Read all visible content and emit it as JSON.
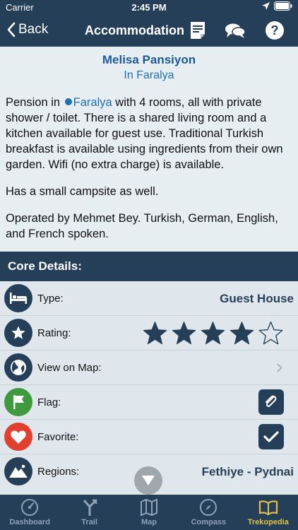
{
  "status": {
    "carrier": "Carrier",
    "time": "2:45 PM"
  },
  "nav": {
    "back_label": "Back",
    "title": "Accommodation"
  },
  "listing": {
    "name": "Melisa Pansiyon",
    "location": "In Faralya",
    "desc_pre": "Pension in",
    "desc_link": "Faralya",
    "desc_post": " with 4 rooms, all with private shower / toilet. There is a shared living room and a kitchen available for guest use. Traditional Turkish breakfast is available using ingredients from their own garden. Wifi (no extra charge) is available.",
    "para2": "Has a small campsite as well.",
    "para3": "Operated by Mehmet Bey. Turkish, German, English, and French spoken."
  },
  "core": {
    "header": "Core Details:",
    "type_label": "Type:",
    "type_value": "Guest House",
    "rating_label": "Rating:",
    "rating": 4,
    "rating_max": 5,
    "map_label": "View on Map:",
    "flag_label": "Flag:",
    "favorite_label": "Favorite:",
    "favorite": true,
    "regions_label": "Regions:",
    "regions_value": "Fethiye - Pydnai"
  },
  "tabs": [
    {
      "label": "Dashboard",
      "icon": "gauge-icon"
    },
    {
      "label": "Trail",
      "icon": "trail-icon"
    },
    {
      "label": "Map",
      "icon": "map-icon"
    },
    {
      "label": "Compass",
      "icon": "compass-icon"
    },
    {
      "label": "Trekopedia",
      "icon": "book-icon",
      "active": true
    }
  ],
  "colors": {
    "primary": "#263f59",
    "link": "#1f6fb3",
    "active_tab": "#e0c14a",
    "flag_green": "#3f9a3f",
    "favorite_red": "#e2402f"
  }
}
